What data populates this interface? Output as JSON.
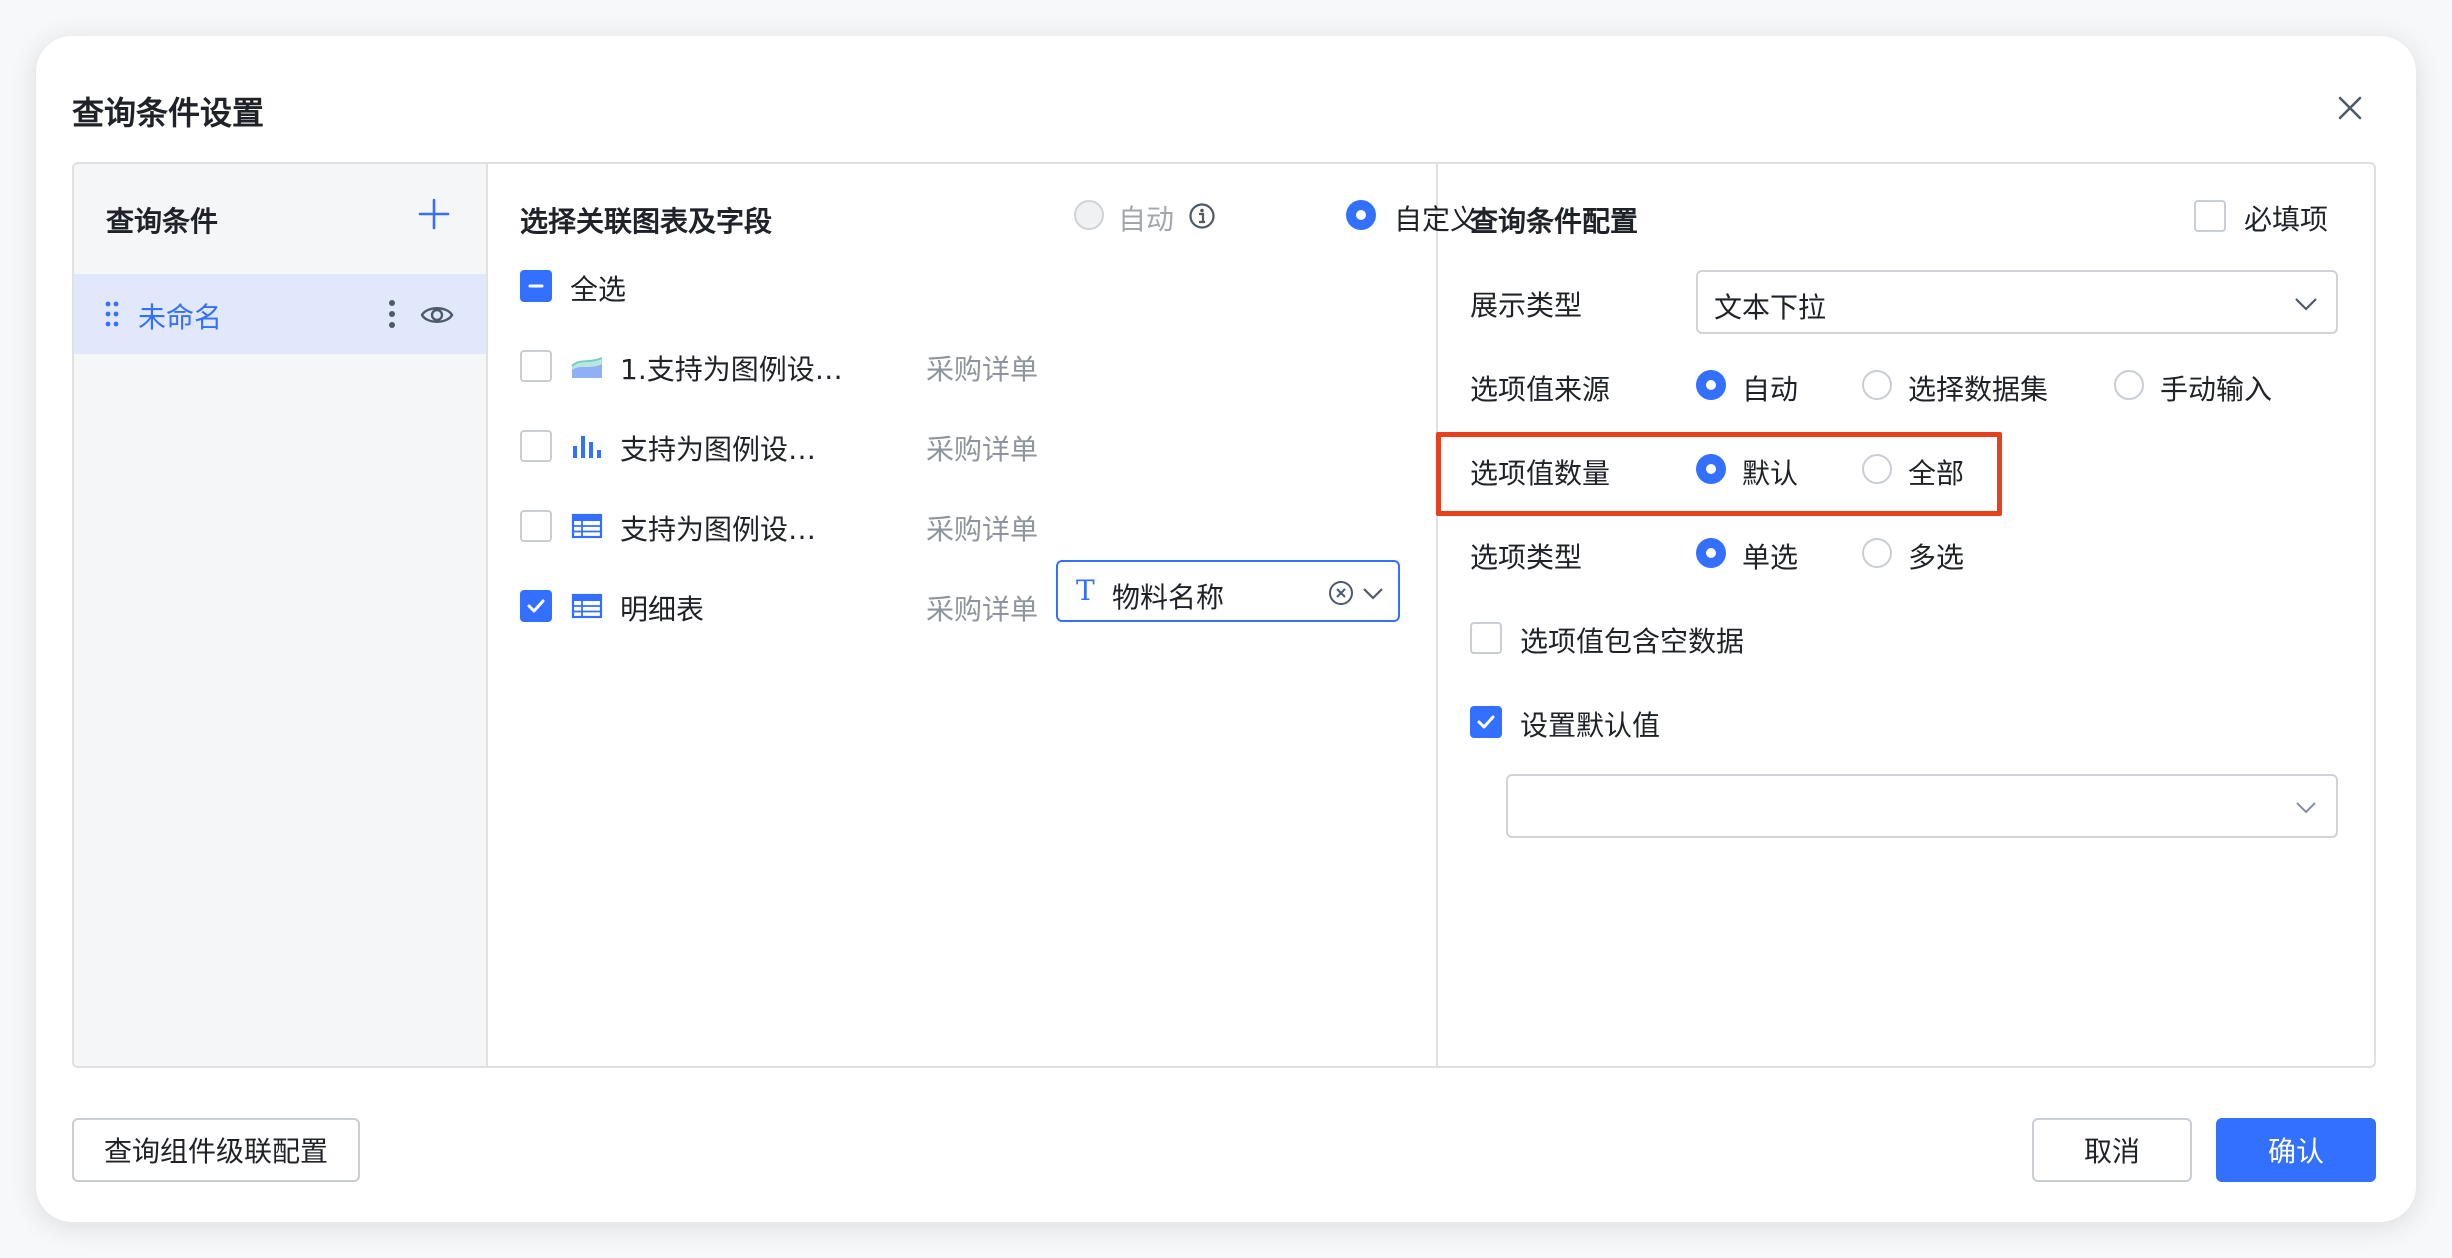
{
  "dialog": {
    "title": "查询条件设置"
  },
  "left": {
    "header": "查询条件",
    "items": [
      {
        "label": "未命名"
      }
    ]
  },
  "middle": {
    "header": "选择关联图表及字段",
    "mode_options": [
      {
        "label": "自动",
        "selected": false,
        "disabled": true
      },
      {
        "label": "自定义",
        "selected": true
      }
    ],
    "select_all_label": "全选",
    "charts": [
      {
        "name": "1.支持为图例设…",
        "dataset": "采购详单",
        "checked": false,
        "icon": "area-chart-icon"
      },
      {
        "name": "支持为图例设…",
        "dataset": "采购详单",
        "checked": false,
        "icon": "bar-chart-icon"
      },
      {
        "name": "支持为图例设…",
        "dataset": "采购详单",
        "checked": false,
        "icon": "table-icon"
      },
      {
        "name": "明细表",
        "dataset": "采购详单",
        "checked": true,
        "icon": "table-icon",
        "field": "物料名称"
      }
    ]
  },
  "right": {
    "header": "查询条件配置",
    "required_label": "必填项",
    "display_type": {
      "label": "展示类型",
      "value": "文本下拉"
    },
    "option_source": {
      "label": "选项值来源",
      "options": [
        "自动",
        "选择数据集",
        "手动输入"
      ],
      "selected": 0
    },
    "option_count": {
      "label": "选项值数量",
      "options": [
        "默认",
        "全部"
      ],
      "selected": 0
    },
    "option_type": {
      "label": "选项类型",
      "options": [
        "单选",
        "多选"
      ],
      "selected": 0
    },
    "include_empty_label": "选项值包含空数据",
    "set_default_label": "设置默认值",
    "default_value": ""
  },
  "footer": {
    "cascade_button": "查询组件级联配置",
    "cancel_button": "取消",
    "confirm_button": "确认"
  },
  "colors": {
    "accent": "#3370ff",
    "highlight": "#e8401c"
  }
}
